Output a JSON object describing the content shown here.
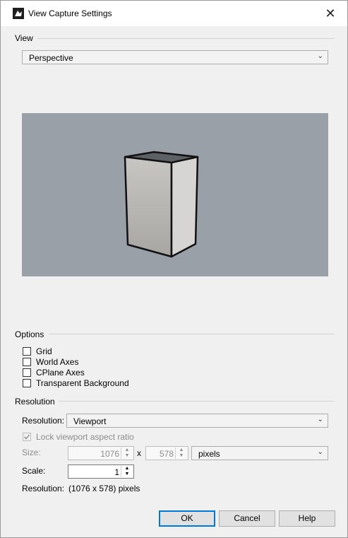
{
  "window": {
    "title": "View Capture Settings"
  },
  "icons": {
    "app": "rhino-icon",
    "close": "close-icon"
  },
  "view": {
    "group_label": "View",
    "selected": "Perspective"
  },
  "options": {
    "group_label": "Options",
    "items": [
      {
        "label": "Grid",
        "checked": false
      },
      {
        "label": "World Axes",
        "checked": false
      },
      {
        "label": "CPlane Axes",
        "checked": false
      },
      {
        "label": "Transparent Background",
        "checked": false
      }
    ]
  },
  "resolution": {
    "group_label": "Resolution",
    "resolution_label": "Resolution:",
    "resolution_value": "Viewport",
    "lock_label": "Lock viewport aspect ratio",
    "lock_checked": true,
    "size_label": "Size:",
    "width": "1076",
    "times": "x",
    "height": "578",
    "units": "pixels",
    "scale_label": "Scale:",
    "scale": "1",
    "summary_label": "Resolution:",
    "summary_value": "(1076 x 578) pixels"
  },
  "buttons": {
    "ok": "OK",
    "cancel": "Cancel",
    "help": "Help"
  },
  "colors": {
    "accent": "#0078d7",
    "preview_bg": "#9aa0a8",
    "dialog_bg": "#f0f0f0"
  }
}
